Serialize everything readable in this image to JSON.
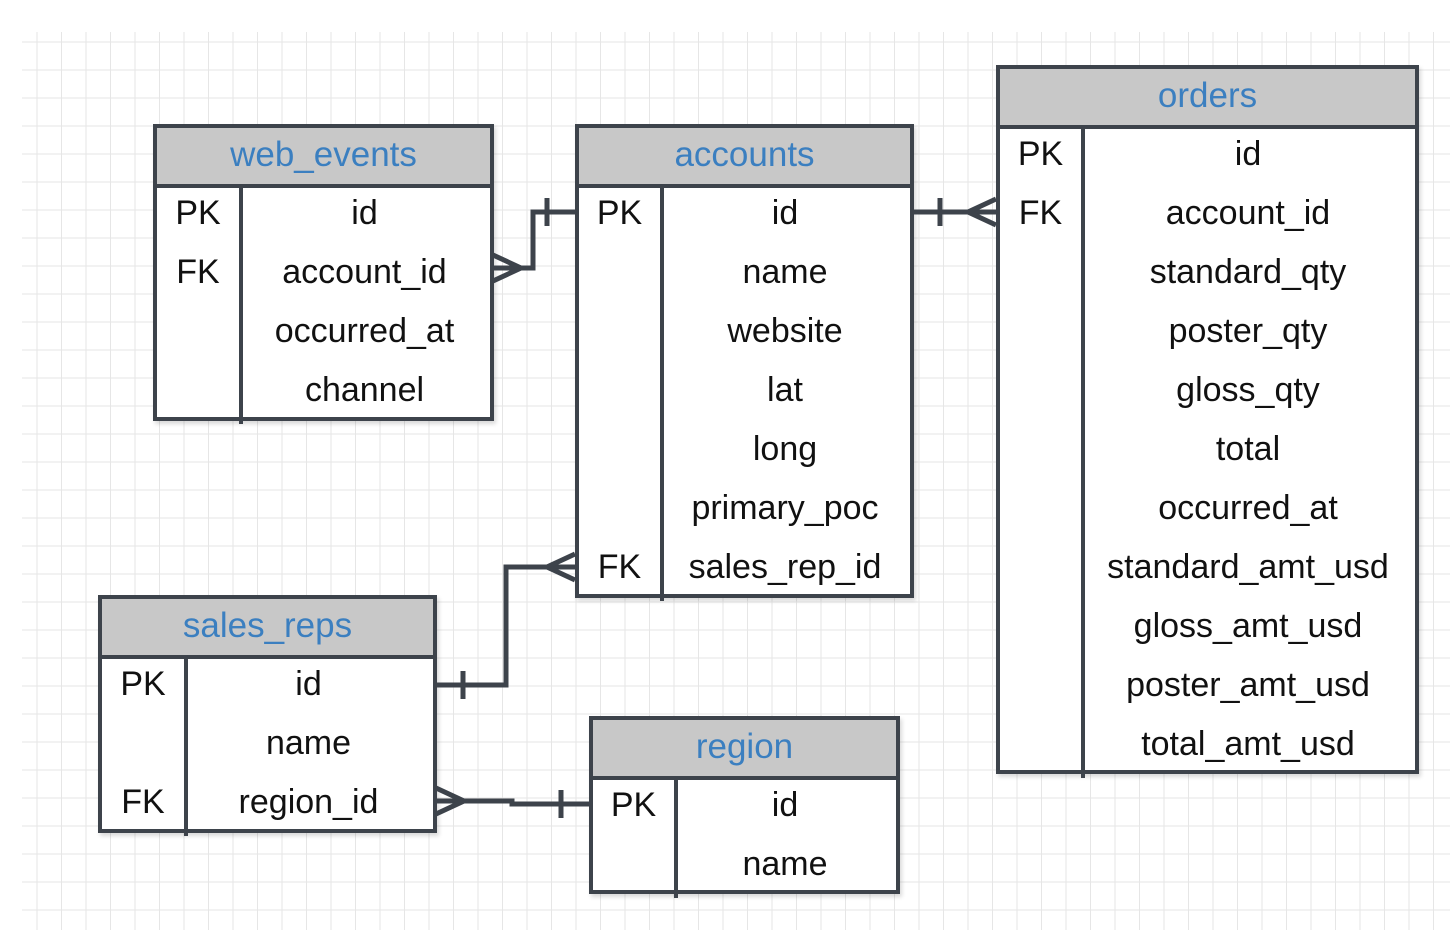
{
  "colors": {
    "border": "#3d434b",
    "header_bg": "#c8c8c8",
    "title": "#3b7fc0",
    "grid": "#e6e6e6"
  },
  "tables": {
    "web_events": {
      "name": "web_events",
      "rows": [
        {
          "key": "PK",
          "field": "id"
        },
        {
          "key": "FK",
          "field": "account_id"
        },
        {
          "key": "",
          "field": "occurred_at"
        },
        {
          "key": "",
          "field": "channel"
        }
      ]
    },
    "accounts": {
      "name": "accounts",
      "rows": [
        {
          "key": "PK",
          "field": "id"
        },
        {
          "key": "",
          "field": "name"
        },
        {
          "key": "",
          "field": "website"
        },
        {
          "key": "",
          "field": "lat"
        },
        {
          "key": "",
          "field": "long"
        },
        {
          "key": "",
          "field": "primary_poc"
        },
        {
          "key": "FK",
          "field": "sales_rep_id"
        }
      ]
    },
    "orders": {
      "name": "orders",
      "rows": [
        {
          "key": "PK",
          "field": "id"
        },
        {
          "key": "FK",
          "field": "account_id"
        },
        {
          "key": "",
          "field": "standard_qty"
        },
        {
          "key": "",
          "field": "poster_qty"
        },
        {
          "key": "",
          "field": "gloss_qty"
        },
        {
          "key": "",
          "field": "total"
        },
        {
          "key": "",
          "field": "occurred_at"
        },
        {
          "key": "",
          "field": "standard_amt_usd"
        },
        {
          "key": "",
          "field": "gloss_amt_usd"
        },
        {
          "key": "",
          "field": "poster_amt_usd"
        },
        {
          "key": "",
          "field": "total_amt_usd"
        }
      ]
    },
    "sales_reps": {
      "name": "sales_reps",
      "rows": [
        {
          "key": "PK",
          "field": "id"
        },
        {
          "key": "",
          "field": "name"
        },
        {
          "key": "FK",
          "field": "region_id"
        }
      ]
    },
    "region": {
      "name": "region",
      "rows": [
        {
          "key": "PK",
          "field": "id"
        },
        {
          "key": "",
          "field": "name"
        }
      ]
    }
  },
  "relationships": [
    {
      "from": "web_events.account_id",
      "to": "accounts.id",
      "cardinality": "many-to-one"
    },
    {
      "from": "orders.account_id",
      "to": "accounts.id",
      "cardinality": "many-to-one"
    },
    {
      "from": "accounts.sales_rep_id",
      "to": "sales_reps.id",
      "cardinality": "many-to-one"
    },
    {
      "from": "sales_reps.region_id",
      "to": "region.id",
      "cardinality": "many-to-one"
    }
  ]
}
